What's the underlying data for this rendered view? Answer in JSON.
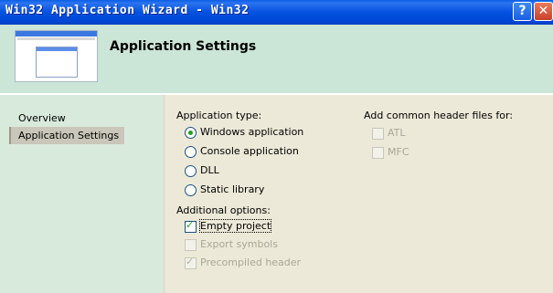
{
  "window": {
    "title": "Win32 Application Wizard - Win32",
    "help_glyph": "?",
    "close_glyph": "✕"
  },
  "header": {
    "title": "Application Settings"
  },
  "sidebar": {
    "items": [
      {
        "label": "Overview",
        "active": false
      },
      {
        "label": "Application Settings",
        "active": true
      }
    ]
  },
  "application_type": {
    "label": "Application type:",
    "options": [
      {
        "label": "Windows application",
        "selected": true
      },
      {
        "label": "Console application",
        "selected": false
      },
      {
        "label": "DLL",
        "selected": false
      },
      {
        "label": "Static library",
        "selected": false
      }
    ]
  },
  "additional_options": {
    "label": "Additional options:",
    "options": [
      {
        "label": "Empty project",
        "checked": true,
        "enabled": true
      },
      {
        "label": "Export symbols",
        "checked": false,
        "enabled": false
      },
      {
        "label": "Precompiled header",
        "checked": true,
        "enabled": false
      }
    ]
  },
  "common_headers": {
    "label": "Add common header files for:",
    "options": [
      {
        "label": "ATL",
        "checked": false,
        "enabled": false
      },
      {
        "label": "MFC",
        "checked": false,
        "enabled": false
      }
    ]
  },
  "colors": {
    "titlebar": "#0451e0",
    "header_bg": "#cbe5d6",
    "sidebar_bg": "#d8eadc",
    "dialog_bg": "#ece9d8",
    "check_accent": "#21a121"
  }
}
